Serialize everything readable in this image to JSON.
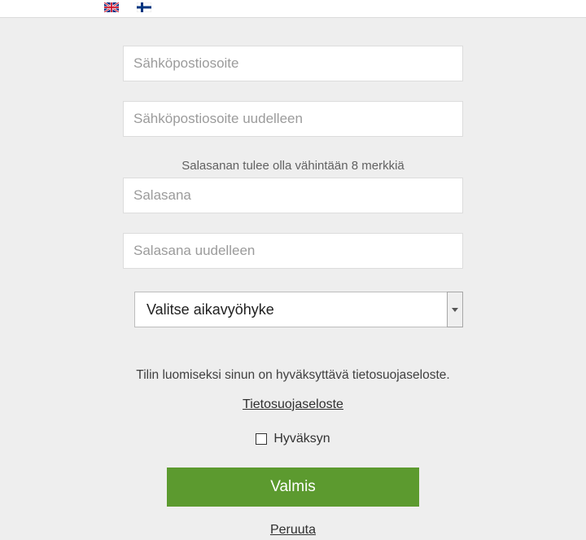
{
  "lang": {
    "english": "English",
    "finnish": "Suomi"
  },
  "form": {
    "email_placeholder": "Sähköpostiosoite",
    "email_repeat_placeholder": "Sähköpostiosoite uudelleen",
    "password_hint": "Salasanan tulee olla vähintään 8 merkkiä",
    "password_placeholder": "Salasana",
    "password_repeat_placeholder": "Salasana uudelleen",
    "timezone_placeholder": "Valitse aikavyöhyke"
  },
  "privacy": {
    "notice": "Tilin luomiseksi sinun on hyväksyttävä tietosuojaseloste.",
    "link_label": "Tietosuojaseloste",
    "accept_label": "Hyväksyn"
  },
  "actions": {
    "submit": "Valmis",
    "cancel": "Peruuta"
  }
}
